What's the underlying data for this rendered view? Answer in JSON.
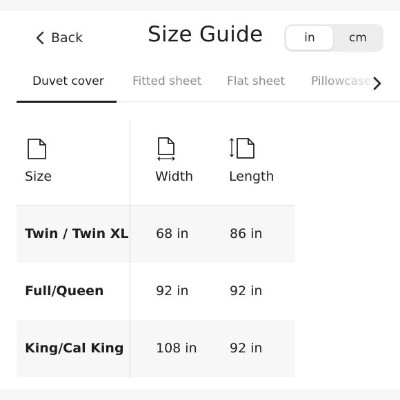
{
  "header": {
    "back_label": "Back",
    "title": "Size Guide",
    "units": [
      "in",
      "cm"
    ],
    "selected_unit": "in"
  },
  "tabs": [
    {
      "label": "Duvet cover",
      "active": true
    },
    {
      "label": "Fitted sheet",
      "active": false
    },
    {
      "label": "Flat sheet",
      "active": false
    },
    {
      "label": "Pillowcases",
      "active": false
    }
  ],
  "table": {
    "headers": {
      "size": "Size",
      "width": "Width",
      "length": "Length"
    },
    "rows": [
      {
        "size": "Twin / Twin XL",
        "width": "68 in",
        "length": "86 in"
      },
      {
        "size": "Full/Queen",
        "width": "92 in",
        "length": "92 in"
      },
      {
        "size": "King/Cal King",
        "width": "108 in",
        "length": "92 in"
      }
    ]
  },
  "colors": {
    "text": "#1e1e1e",
    "muted": "#8a8a8a",
    "shade": "#f7f7f7",
    "toggle_bg": "#ededed"
  }
}
